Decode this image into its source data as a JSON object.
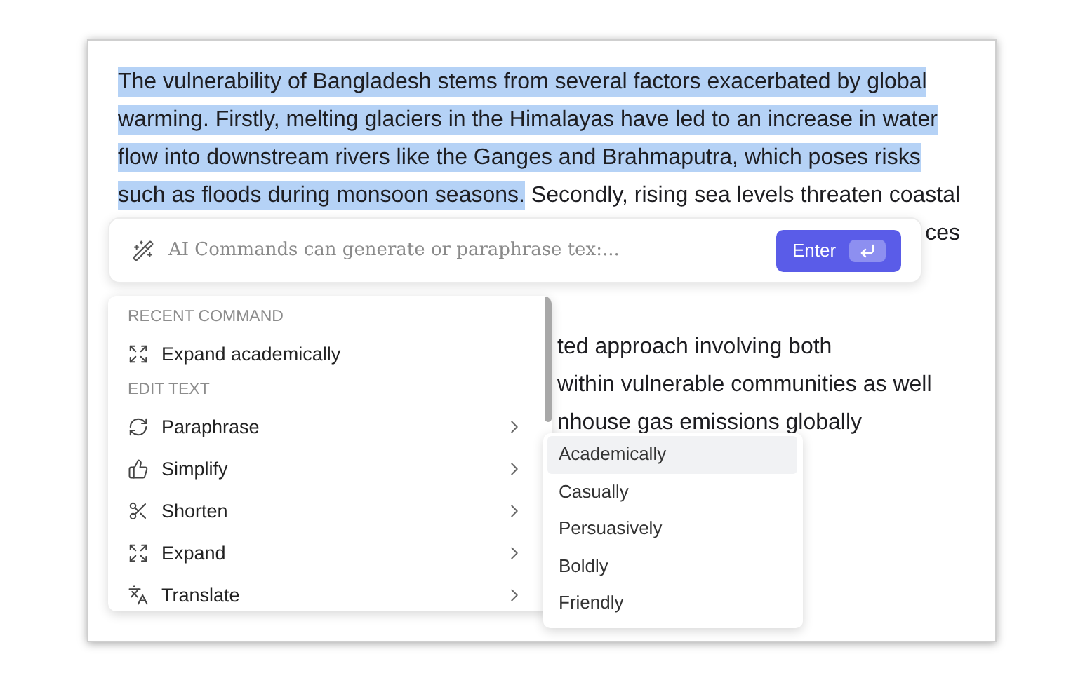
{
  "document": {
    "paragraphs": [
      {
        "lines": [
          {
            "kind": "full",
            "segments": [
              {
                "text": "The vulnerability of Bangladesh stems from several factors exacerbated by global",
                "highlighted": true
              }
            ]
          },
          {
            "kind": "full",
            "segments": [
              {
                "text": "warming. Firstly, melting glaciers in the Himalayas have led to an increase in water",
                "highlighted": true
              }
            ]
          },
          {
            "kind": "full",
            "segments": [
              {
                "text": "flow into downstream rivers like the Ganges and Brahmaputra, which poses risks",
                "highlighted": true
              }
            ]
          },
          {
            "kind": "full",
            "segments": [
              {
                "text": "such as floods during monsoon seasons.",
                "highlighted": true
              },
              {
                "text": " Secondly, rising sea levels threaten coastal",
                "highlighted": false
              }
            ]
          },
          {
            "kind": "tail",
            "segments": [
              {
                "text": "ces",
                "highlighted": false
              }
            ]
          }
        ]
      },
      {
        "lines": [
          {
            "kind": "fragment",
            "segments": [
              {
                "text": "ted approach involving both",
                "highlighted": false
              }
            ]
          },
          {
            "kind": "fragment",
            "segments": [
              {
                "text": "within vulnerable communities as well",
                "highlighted": false
              }
            ]
          },
          {
            "kind": "fragment",
            "segments": [
              {
                "text": "nhouse gas emissions globally",
                "highlighted": false
              }
            ]
          }
        ]
      }
    ]
  },
  "command_bar": {
    "placeholder": "AI Commands can generate or paraphrase tex:...",
    "button": "Enter"
  },
  "menu": {
    "sections": [
      {
        "title": "RECENT COMMAND",
        "items": [
          {
            "label": "Expand academically",
            "has_submenu": false
          }
        ]
      },
      {
        "title": "EDIT TEXT",
        "items": [
          {
            "label": "Paraphrase",
            "has_submenu": true
          },
          {
            "label": "Simplify",
            "has_submenu": true
          },
          {
            "label": "Shorten",
            "has_submenu": true
          },
          {
            "label": "Expand",
            "has_submenu": true
          },
          {
            "label": "Translate",
            "has_submenu": true
          }
        ]
      }
    ]
  },
  "submenu": {
    "items": [
      {
        "label": "Academically",
        "selected": true
      },
      {
        "label": "Casually",
        "selected": false
      },
      {
        "label": "Persuasively",
        "selected": false
      },
      {
        "label": "Boldly",
        "selected": false
      },
      {
        "label": "Friendly",
        "selected": false
      }
    ]
  }
}
